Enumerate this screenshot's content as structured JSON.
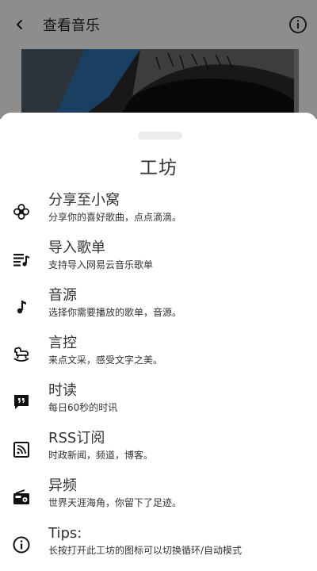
{
  "background_page": {
    "title": "查看音乐",
    "back_icon": "back-arrow-icon",
    "info_icon": "info-icon"
  },
  "sheet": {
    "title": "工坊",
    "items": [
      {
        "icon": "flower-icon",
        "title": "分享至小窝",
        "subtitle": "分享你的喜好歌曲，点点滴滴。"
      },
      {
        "icon": "playlist-import-icon",
        "title": "导入歌单",
        "subtitle": "支持导入网易云音乐歌单"
      },
      {
        "icon": "music-note-icon",
        "title": "音源",
        "subtitle": "选择你需要播放的歌单，音源。"
      },
      {
        "icon": "rocking-horse-icon",
        "title": "言控",
        "subtitle": "来点文采，感受文字之美。"
      },
      {
        "icon": "quote-bubble-icon",
        "title": "时读",
        "subtitle": "每日60秒的时讯"
      },
      {
        "icon": "rss-feed-icon",
        "title": "RSS订阅",
        "subtitle": "时政新闻，频道，博客。"
      },
      {
        "icon": "radio-icon",
        "title": "异频",
        "subtitle": "世界天涯海角，你留下了足迹。"
      },
      {
        "icon": "info-icon",
        "title": "Tips:",
        "subtitle": "长按打开此工坊的图标可以切换循环/自动模式"
      }
    ]
  },
  "colors": {
    "text_primary": "#333333",
    "scrim": "rgba(0,0,0,0.42)",
    "sheet_background": "#ffffff",
    "handle": "#ececec"
  }
}
